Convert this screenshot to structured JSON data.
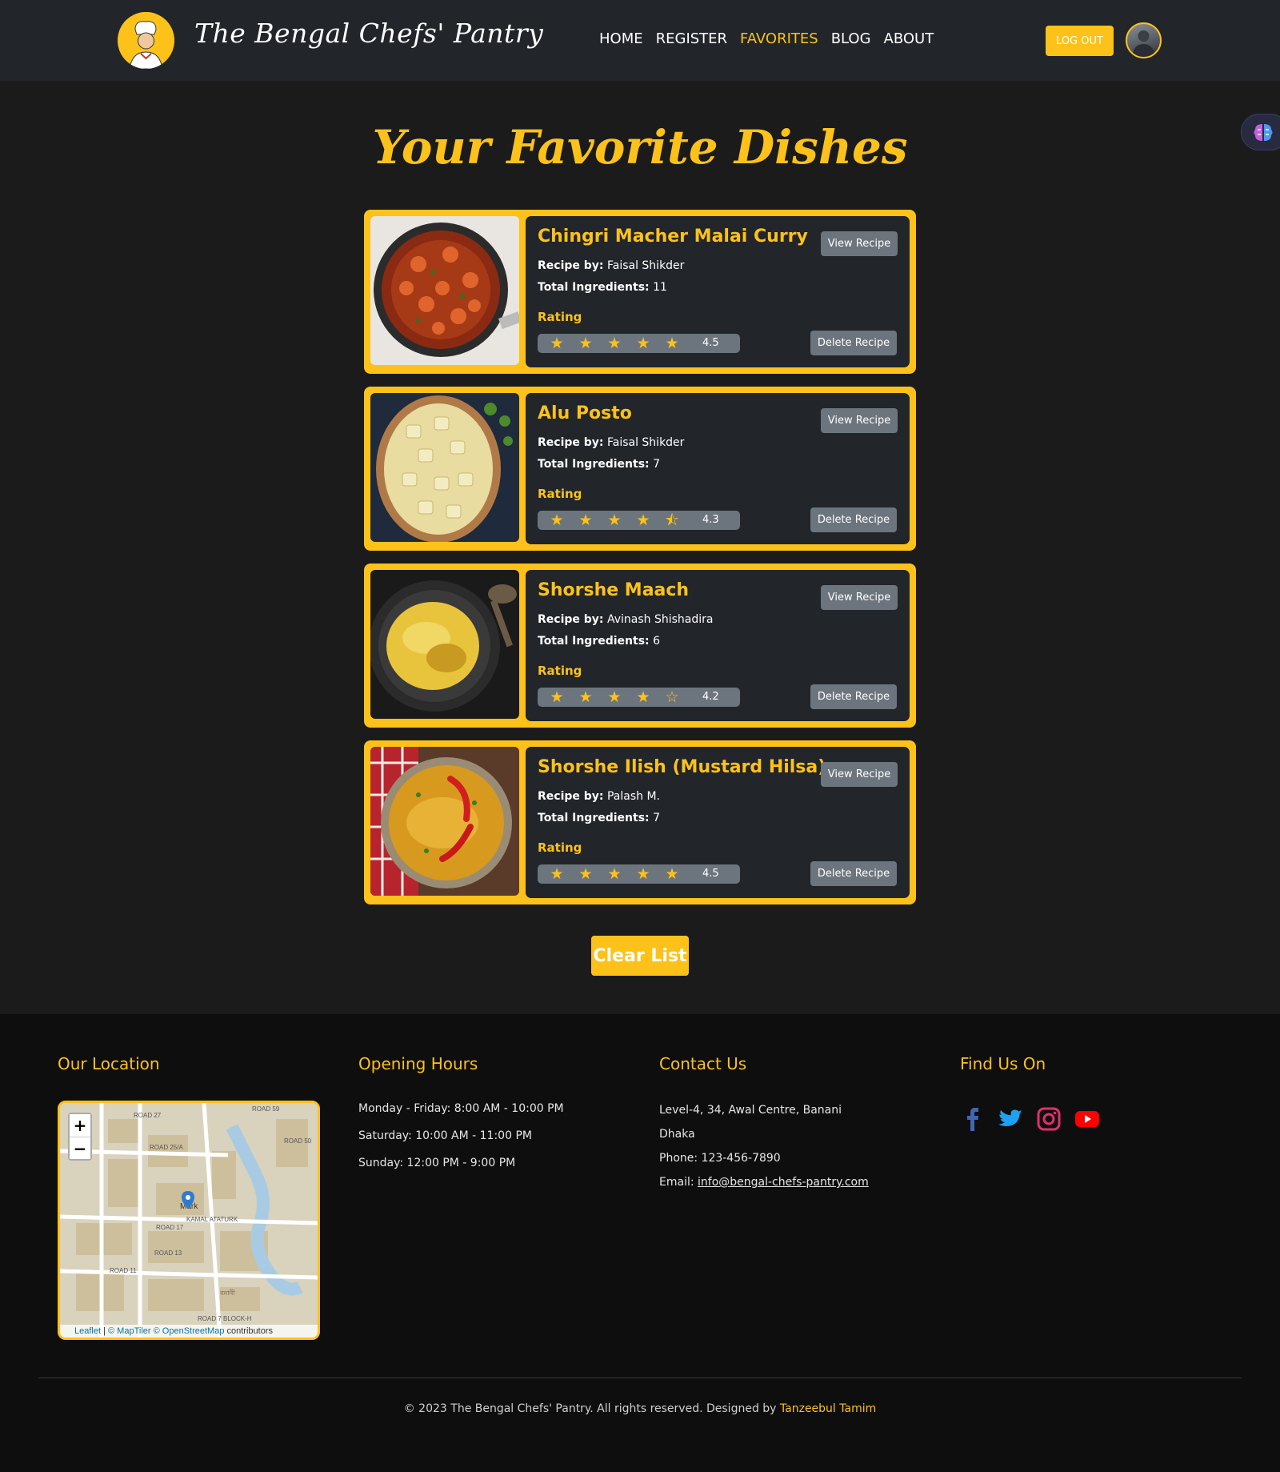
{
  "nav": {
    "brand": "The Bengal Chefs' Pantry",
    "links": [
      "HOME",
      "REGISTER",
      "FAVORITES",
      "BLOG",
      "ABOUT"
    ],
    "active_link": "FAVORITES",
    "logout_label": "LOG OUT"
  },
  "page_title": "Your Favorite Dishes",
  "recipe_labels": {
    "recipe_by": "Recipe by:",
    "total_ingredients": "Total Ingredients:",
    "rating": "Rating",
    "view_button": "View Recipe",
    "delete_button": "Delete Recipe"
  },
  "recipes": [
    {
      "name": "Chingri Macher Malai Curry",
      "chef": "Faisal Shikder",
      "ingredients": "11",
      "rating": "4.5",
      "stars": [
        "full",
        "full",
        "full",
        "full",
        "full"
      ]
    },
    {
      "name": "Alu Posto",
      "chef": "Faisal Shikder",
      "ingredients": "7",
      "rating": "4.3",
      "stars": [
        "full",
        "full",
        "full",
        "full",
        "half"
      ]
    },
    {
      "name": "Shorshe Maach",
      "chef": "Avinash Shishadira",
      "ingredients": "6",
      "rating": "4.2",
      "stars": [
        "full",
        "full",
        "full",
        "full",
        "empty"
      ]
    },
    {
      "name": "Shorshe Ilish (Mustard Hilsa)",
      "chef": "Palash M.",
      "ingredients": "7",
      "rating": "4.5",
      "stars": [
        "full",
        "full",
        "full",
        "full",
        "full"
      ]
    }
  ],
  "clear_label": "Clear List",
  "footer": {
    "location_heading": "Our Location",
    "hours_heading": "Opening Hours",
    "contact_heading": "Contact Us",
    "social_heading": "Find Us On",
    "hours": [
      "Monday - Friday: 8:00 AM - 10:00 PM",
      "Saturday: 10:00 AM - 11:00 PM",
      "Sunday: 12:00 PM - 9:00 PM"
    ],
    "address_line1": "Level-4, 34, Awal Centre, Banani",
    "address_line2": "Dhaka",
    "phone": "Phone: 123-456-7890",
    "email_label": "Email:",
    "email": "info@bengal-chefs-pantry.com",
    "map": {
      "zoom_in": "+",
      "zoom_out": "−",
      "attribution_leaflet": "Leaflet",
      "attribution_sep": "|",
      "attribution_maptiler": "© MapTiler",
      "attribution_osm": "© OpenStreetMap",
      "attribution_tail": "contributors",
      "marker_label": "Mark",
      "road_labels": [
        "ROAD 27",
        "ROAD 25/A",
        "ROAD 17",
        "KAMAL ATATURK",
        "ROAD 13",
        "ROAD 11",
        "ROAD 7 BLOCK-H",
        "বনানী",
        "ROAD 59",
        "ROAD 50"
      ]
    },
    "social_icons": [
      "facebook-icon",
      "twitter-icon",
      "instagram-icon",
      "youtube-icon"
    ],
    "copyright": "© 2023 The Bengal Chefs' Pantry. All rights reserved. Designed by",
    "author": "Tanzeebul Tamim"
  },
  "colors": {
    "accent": "#fcc21a",
    "background": "#1b1b1c",
    "card_body": "#22252a",
    "button_gray": "#6c757d",
    "footer": "#0e0e0f"
  }
}
